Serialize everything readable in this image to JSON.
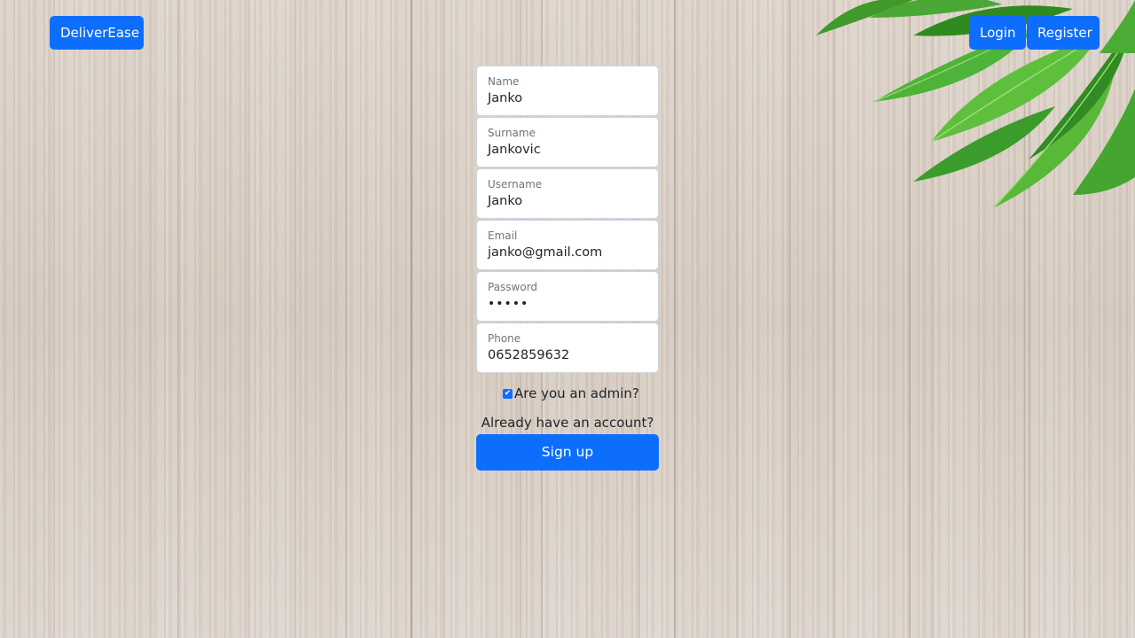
{
  "navbar": {
    "brand_label": "DeliverEase",
    "login_label": "Login",
    "register_label": "Register"
  },
  "form": {
    "fields": [
      {
        "label": "Name",
        "value": "Janko"
      },
      {
        "label": "Surname",
        "value": "Jankovic"
      },
      {
        "label": "Username",
        "value": "Janko"
      },
      {
        "label": "Email",
        "value": "janko@gmail.com"
      },
      {
        "label": "Password",
        "value": "•••••"
      },
      {
        "label": "Phone",
        "value": "0652859632"
      }
    ],
    "admin_checkbox": {
      "label": "Are you an admin?",
      "checked": true
    },
    "account_link": "Already have an account?",
    "submit_label": "Sign up"
  },
  "colors": {
    "primary": "#0d6efd",
    "background": "#d6cbc1"
  },
  "decorations": {
    "background": "wood-texture",
    "corner": "green-leaves"
  }
}
